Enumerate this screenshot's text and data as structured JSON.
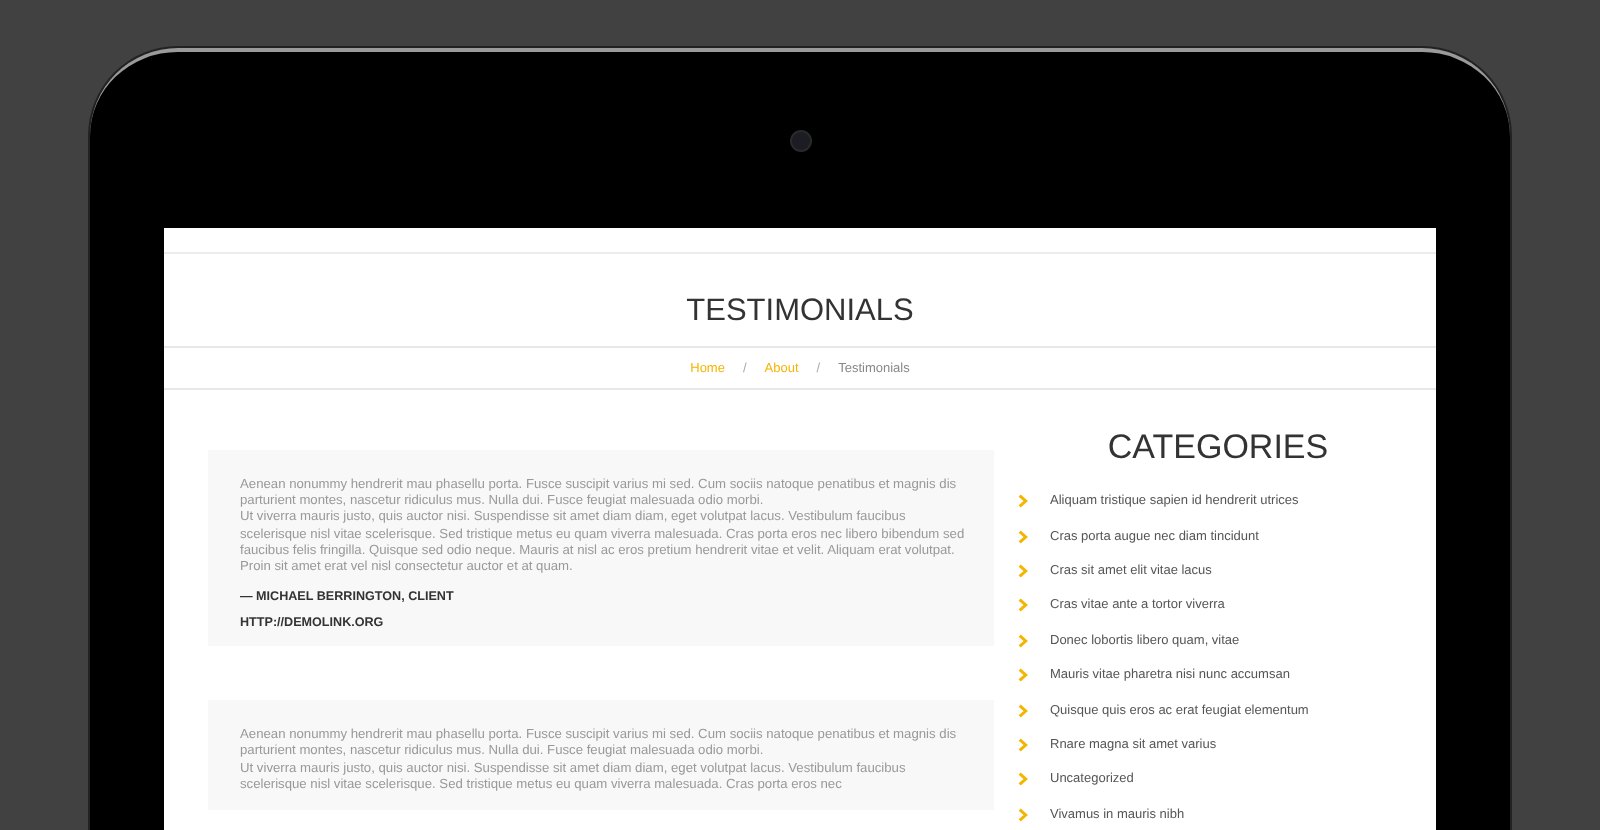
{
  "page": {
    "title": "TESTIMONIALS",
    "breadcrumb": [
      {
        "label": "Home",
        "kind": "link"
      },
      {
        "label": "About",
        "kind": "link"
      },
      {
        "label": "Testimonials",
        "kind": "current"
      }
    ],
    "breadcrumb_separator": "/"
  },
  "testimonials": [
    {
      "paragraphs": [
        "Aenean nonummy hendrerit mau phasellu porta. Fusce suscipit varius mi sed. Cum sociis natoque penatibus et magnis dis parturient montes, nascetur ridiculus mus. Nulla dui. Fusce feugiat malesuada odio morbi.",
        "Ut viverra mauris justo, quis auctor nisi. Suspendisse sit amet diam diam, eget volutpat lacus. Vestibulum faucibus scelerisque nisl vitae scelerisque. Sed tristique metus eu quam viverra malesuada. Cras porta eros nec libero bibendum sed faucibus felis fringilla. Quisque sed odio neque. Mauris at nisl ac eros pretium hendrerit vitae et velit. Aliquam erat volutpat. Proin sit amet erat vel nisl consectetur auctor et at quam."
      ],
      "author": "— MICHAEL BERRINGTON, CLIENT",
      "link": "HTTP://DEMOLINK.ORG"
    },
    {
      "paragraphs": [
        "Aenean nonummy hendrerit mau phasellu porta. Fusce suscipit varius mi sed. Cum sociis natoque penatibus et magnis dis parturient montes, nascetur ridiculus mus. Nulla dui. Fusce feugiat malesuada odio morbi.",
        "Ut viverra mauris justo, quis auctor nisi. Suspendisse sit amet diam diam, eget volutpat lacus. Vestibulum faucibus scelerisque nisl vitae scelerisque. Sed tristique metus eu quam viverra malesuada. Cras porta eros nec"
      ]
    }
  ],
  "sidebar": {
    "title": "CATEGORIES",
    "items": [
      "Aliquam tristique sapien id hendrerit utrices",
      "Cras porta augue nec diam tincidunt",
      "Cras sit amet elit vitae lacus",
      "Cras vitae ante a tortor viverra",
      "Donec lobortis libero quam, vitae",
      "Mauris vitae pharetra nisi nunc accumsan",
      "Quisque quis eros ac erat feugiat elementum",
      "Rnare magna sit amet varius",
      "Uncategorized",
      "Vivamus in mauris nibh"
    ]
  }
}
